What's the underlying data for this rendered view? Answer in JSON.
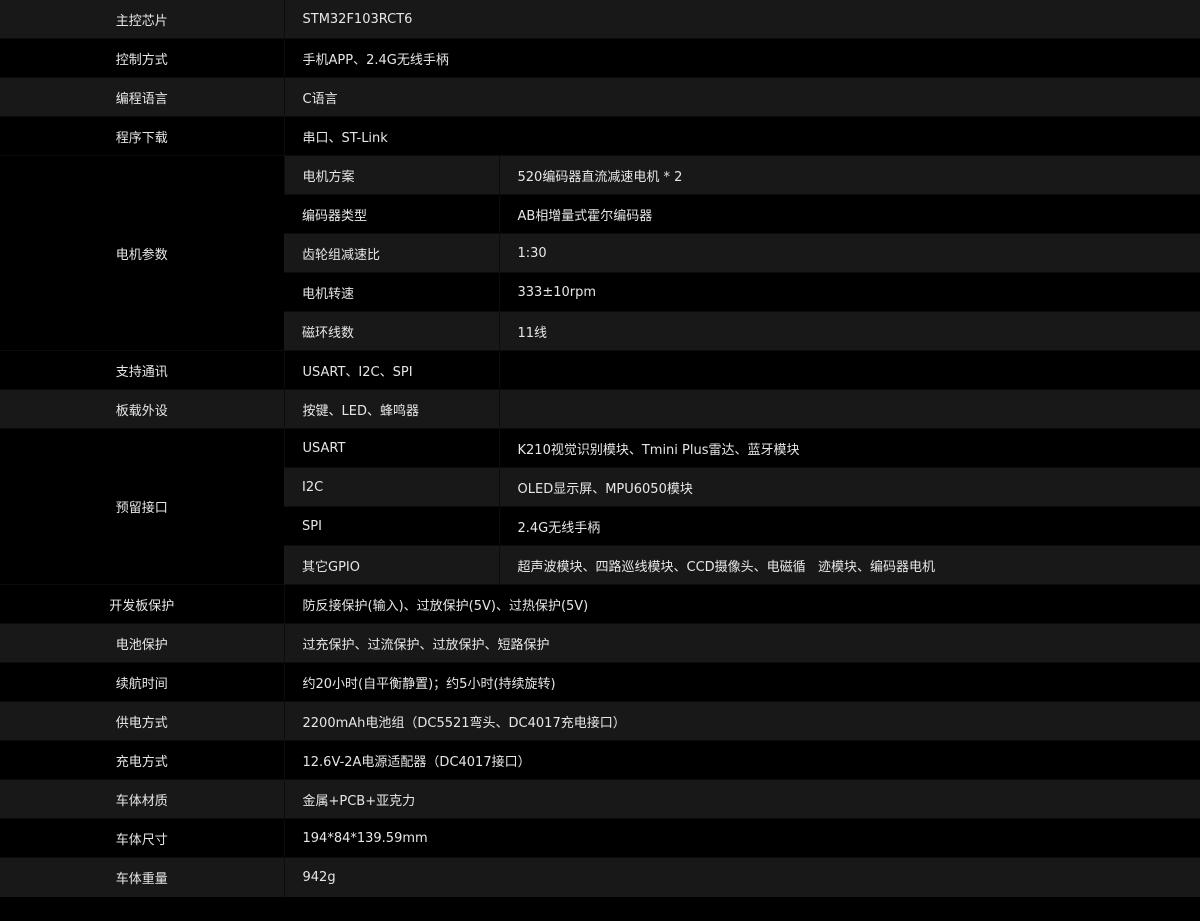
{
  "rows": [
    {
      "key": "主控芯片",
      "value": "STM32F103RCT6"
    },
    {
      "key": "控制方式",
      "value": "手机APP、2.4G无线手柄"
    },
    {
      "key": "编程语言",
      "value": "C语言"
    },
    {
      "key": "程序下载",
      "value": "串口、ST-Link"
    }
  ],
  "motor": {
    "key": "电机参数",
    "items": [
      {
        "label": "电机方案",
        "value": "520编码器直流减速电机 * 2"
      },
      {
        "label": "编码器类型",
        "value": "AB相增量式霍尔编码器"
      },
      {
        "label": "齿轮组减速比",
        "value": "1:30"
      },
      {
        "label": "电机转速",
        "value": "333±10rpm"
      },
      {
        "label": "磁环线数",
        "value": "11线"
      }
    ]
  },
  "rows2": [
    {
      "key": "支持通讯",
      "value": "USART、I2C、SPI"
    },
    {
      "key": "板载外设",
      "value": "按键、LED、蜂鸣器"
    }
  ],
  "ports": {
    "key": "预留接口",
    "items": [
      {
        "label": "USART",
        "value": "K210视觉识别模块、Tmini Plus雷达、蓝牙模块"
      },
      {
        "label": "I2C",
        "value": "OLED显示屏、MPU6050模块"
      },
      {
        "label": "SPI",
        "value": "2.4G无线手柄"
      },
      {
        "label": "其它GPIO",
        "value": "超声波模块、四路巡线模块、CCD摄像头、电磁循   迹模块、编码器电机"
      }
    ]
  },
  "rows3": [
    {
      "key": "开发板保护",
      "value": "防反接保护(输入)、过放保护(5V)、过热保护(5V)"
    },
    {
      "key": "电池保护",
      "value": "过充保护、过流保护、过放保护、短路保护"
    },
    {
      "key": "续航时间",
      "value": "约20小时(自平衡静置)；约5小时(持续旋转)"
    },
    {
      "key": "供电方式",
      "value": "2200mAh电池组（DC5521弯头、DC4017充电接口）"
    },
    {
      "key": "充电方式",
      "value": "12.6V-2A电源适配器（DC4017接口）"
    },
    {
      "key": "车体材质",
      "value": "金属+PCB+亚克力"
    },
    {
      "key": "车体尺寸",
      "value": "194*84*139.59mm"
    },
    {
      "key": "车体重量",
      "value": "942g"
    }
  ]
}
